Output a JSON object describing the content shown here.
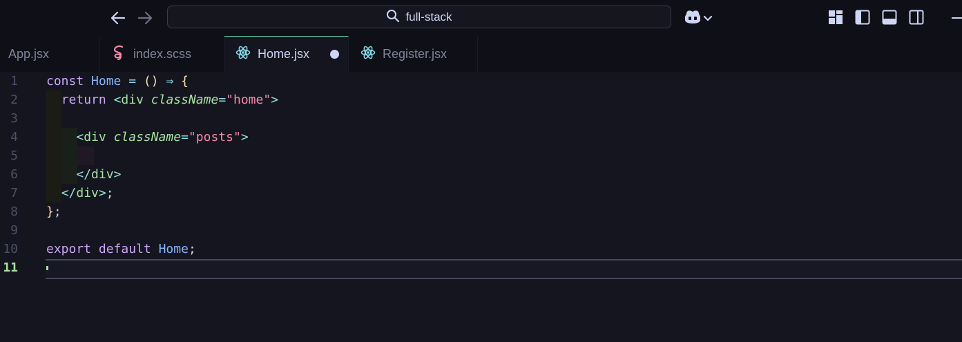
{
  "titlebar": {
    "search_text": "full-stack",
    "icons": [
      "arrow-left-icon",
      "arrow-right-icon",
      "search-icon",
      "copilot-icon",
      "chevron-down-icon",
      "customize-layout-icon",
      "toggle-primary-sidebar-icon",
      "toggle-panel-icon",
      "toggle-secondary-sidebar-icon",
      "minimize-icon"
    ]
  },
  "tabs": [
    {
      "label": "App.jsx",
      "icon": "react-icon",
      "active": false
    },
    {
      "label": "index.scss",
      "icon": "sass-icon",
      "active": false
    },
    {
      "label": "Home.jsx",
      "icon": "react-icon",
      "active": true,
      "dirty": true
    },
    {
      "label": "Register.jsx",
      "icon": "react-icon",
      "active": false
    }
  ],
  "editor": {
    "current_line": 11,
    "line_numbers": [
      "1",
      "2",
      "3",
      "4",
      "5",
      "6",
      "7",
      "8",
      "9",
      "10",
      "11"
    ],
    "tokens": {
      "const": "const",
      "home": "Home",
      "eq": "=",
      "parens": "()",
      "arrow": "⇒",
      "lbrace": "{",
      "return": "return",
      "lt": "<",
      "lt_slash": "</",
      "gt": ">",
      "div": "div",
      "classname": "className",
      "str_home": "\"home\"",
      "str_posts": "\"posts\"",
      "semicolon": ";",
      "rbrace": "}",
      "export": "export",
      "default": "default"
    }
  },
  "colors": {
    "background": "#15151f",
    "titlebar": "#0f0f17",
    "active_tab_border": "#5ed3a6",
    "keyword": "#cba6f7",
    "identifier": "#89b4fa",
    "tag": "#a6e3a1",
    "string": "#f38ba8",
    "bracket": "#f9e2af"
  }
}
